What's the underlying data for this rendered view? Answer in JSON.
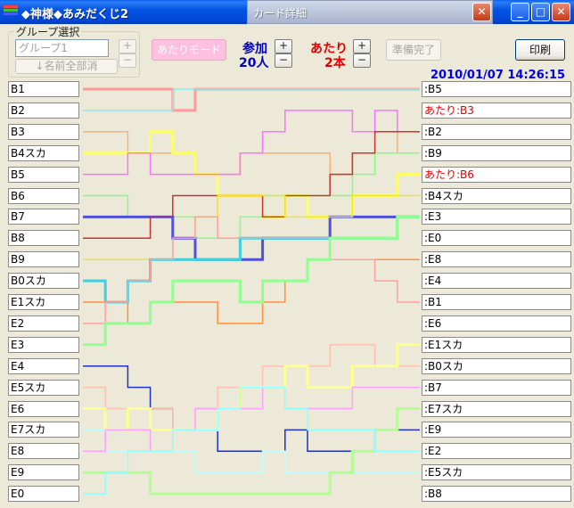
{
  "window": {
    "title": "◆神様◆あみだくじ2",
    "icon_colors": [
      "#ff4040",
      "#40c040",
      "#4060ff"
    ]
  },
  "popup": {
    "title": "カード詳細"
  },
  "controls": {
    "group_label": "グループ選択",
    "group_value": "グループ1",
    "name_all_clear": "↓名前全部消",
    "atari_mode": "あたりモード",
    "participants_label": "参加",
    "participants_value": "20人",
    "hits_label": "あたり",
    "hits_value": "2本",
    "ready": "準備完了",
    "print": "印刷",
    "plus": "+",
    "minus": "−"
  },
  "datetime": "2010/01/07 14:26:15",
  "players": [
    "B1",
    "B2",
    "B3",
    "B4スカ",
    "B5",
    "B6",
    "B7",
    "B8",
    "B9",
    "B0スカ",
    "E1スカ",
    "E2",
    "E3",
    "E4",
    "E5スカ",
    "E6",
    "E7スカ",
    "E8",
    "E9",
    "E0"
  ],
  "results": [
    {
      "text": ":B5",
      "hit": false
    },
    {
      "text": "あたり:B3",
      "hit": true
    },
    {
      "text": ":B2",
      "hit": false
    },
    {
      "text": ":B9",
      "hit": false
    },
    {
      "text": "あたり:B6",
      "hit": true
    },
    {
      "text": ":B4スカ",
      "hit": false
    },
    {
      "text": ":E3",
      "hit": false
    },
    {
      "text": ":E0",
      "hit": false
    },
    {
      "text": ":E8",
      "hit": false
    },
    {
      "text": ":E4",
      "hit": false
    },
    {
      "text": ":B1",
      "hit": false
    },
    {
      "text": ":E6",
      "hit": false
    },
    {
      "text": ":E1スカ",
      "hit": false
    },
    {
      "text": ":B0スカ",
      "hit": false
    },
    {
      "text": ":B7",
      "hit": false
    },
    {
      "text": ":E7スカ",
      "hit": false
    },
    {
      "text": ":E9",
      "hit": false
    },
    {
      "text": ":E2",
      "hit": false
    },
    {
      "text": ":E5スカ",
      "hit": false
    },
    {
      "text": ":B8",
      "hit": false
    }
  ],
  "path_colors": [
    "#ff9a9a",
    "#80f0f0",
    "#ffb070",
    "#ffff60",
    "#ff70ff",
    "#80ff80",
    "#5050e0",
    "#d03030",
    "#f0e040",
    "#40d0e0",
    "#ff9040",
    "#ffa0a0",
    "#90ff90",
    "#2030c0",
    "#ffc0b0",
    "#ffff90",
    "#c0ffff",
    "#ffa0ff",
    "#b0ff90",
    "#90ffff"
  ]
}
